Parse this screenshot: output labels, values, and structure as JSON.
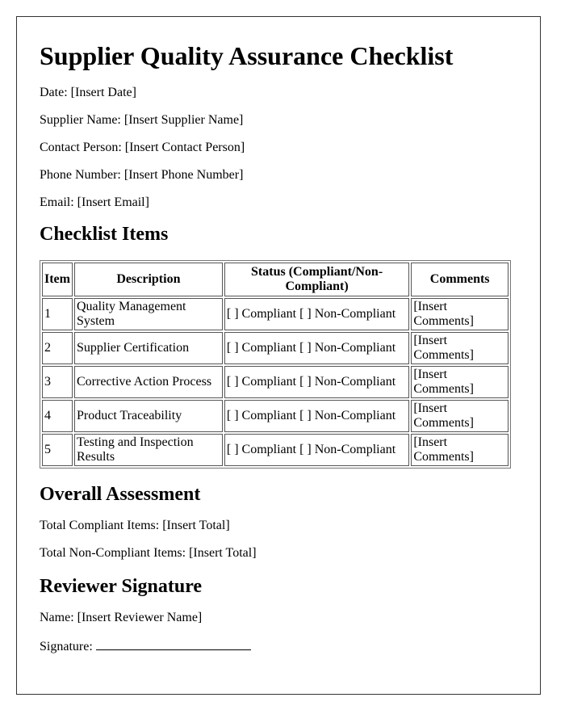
{
  "title": "Supplier Quality Assurance Checklist",
  "meta": [
    {
      "label": "Date:",
      "value": "[Insert Date]"
    },
    {
      "label": "Supplier Name:",
      "value": "[Insert Supplier Name]"
    },
    {
      "label": "Contact Person:",
      "value": "[Insert Contact Person]"
    },
    {
      "label": "Phone Number:",
      "value": "[Insert Phone Number]"
    },
    {
      "label": "Email:",
      "value": "[Insert Email]"
    }
  ],
  "checklist": {
    "heading": "Checklist Items",
    "columns": [
      "Item",
      "Description",
      "Status (Compliant/Non-Compliant)",
      "Comments"
    ],
    "rows": [
      {
        "item": "1",
        "description": "Quality Management System",
        "status": "[ ] Compliant [ ] Non-Compliant",
        "comments": "[Insert Comments]"
      },
      {
        "item": "2",
        "description": "Supplier Certification",
        "status": "[ ] Compliant [ ] Non-Compliant",
        "comments": "[Insert Comments]"
      },
      {
        "item": "3",
        "description": "Corrective Action Process",
        "status": "[ ] Compliant [ ] Non-Compliant",
        "comments": "[Insert Comments]"
      },
      {
        "item": "4",
        "description": "Product Traceability",
        "status": "[ ] Compliant [ ] Non-Compliant",
        "comments": "[Insert Comments]"
      },
      {
        "item": "5",
        "description": "Testing and Inspection Results",
        "status": "[ ] Compliant [ ] Non-Compliant",
        "comments": "[Insert Comments]"
      }
    ]
  },
  "overall": {
    "heading": "Overall Assessment",
    "compliant": "Total Compliant Items: [Insert Total]",
    "non_compliant": "Total Non-Compliant Items: [Insert Total]"
  },
  "reviewer": {
    "heading": "Reviewer Signature",
    "name": "Name: [Insert Reviewer Name]",
    "signature_label": "Signature:"
  }
}
